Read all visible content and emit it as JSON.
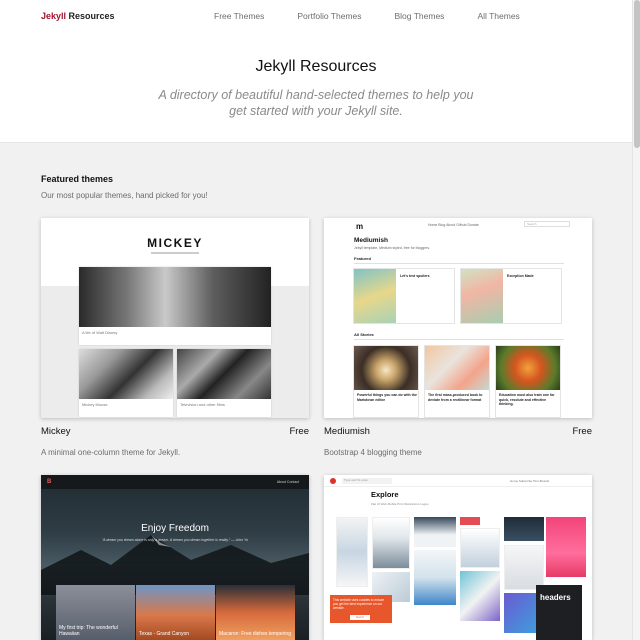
{
  "brand": {
    "prefix": "Jekyll",
    "suffix": " Resources"
  },
  "nav": [
    "Free Themes",
    "Portfolio Themes",
    "Blog Themes",
    "All Themes"
  ],
  "hero": {
    "title": "Jekyll Resources",
    "subtitle": "A directory of beautiful hand-selected themes to help you get started with your Jekyll site."
  },
  "featured": {
    "title": "Featured themes",
    "subtitle": "Our most popular themes, hand picked for you!"
  },
  "cards": [
    {
      "name": "Mickey",
      "price": "Free",
      "description": "A minimal one-column theme for Jekyll.",
      "preview": {
        "title": "MICKEY",
        "captions": [
          "A life of Walt Disney",
          "Mickey Mouse",
          "Television and other films"
        ]
      }
    },
    {
      "name": "Mediumish",
      "price": "Free",
      "description": "Bootstrap 4 blogging theme",
      "preview": {
        "logo": "m",
        "nav": "Home   Blog   About   Github   Donate",
        "search": "Search",
        "title": "Mediumish",
        "tagline": "Jekyll template, Medium styled, free for bloggers.",
        "section_featured": "Featured",
        "section_all": "All Stories",
        "featured_posts": [
          "Let's test spoilers",
          "Exception Made"
        ],
        "stories": [
          "Powerful things you can do with the Markdown editor",
          "The first mass-produced book to deviate from a rectilinear format",
          "Education must also train one for quick, resolute and effective thinking."
        ]
      }
    },
    {
      "name": "",
      "price": "",
      "description": "",
      "preview": {
        "logo": "B",
        "nav": "About   Contact",
        "title": "Enjoy Freedom",
        "subtitle": "\"A dream you dream alone is only a dream. A dream you dream together is reality.\" — John Yo",
        "cards": [
          "My first trip: The wonderful Hawaiian",
          "Texas - Grand Canyon",
          "Macaron: Free dishes tempering"
        ]
      }
    },
    {
      "name": "",
      "price": "",
      "description": "",
      "preview": {
        "search": "Type and hit enter",
        "nav": "Home   Subscribe   Pins   Boards",
        "title": "Explore",
        "tabs": "Flat   UI   Web   Mobile   Print   Illustrations   Logos",
        "popup": "This website uses cookies to ensure you get the best experience on our website.",
        "popup_button": "Got it!",
        "tile_label": "headers"
      }
    }
  ],
  "colors": {
    "brand_accent": "#a0142c",
    "page_bg": "#f1f1f1"
  }
}
